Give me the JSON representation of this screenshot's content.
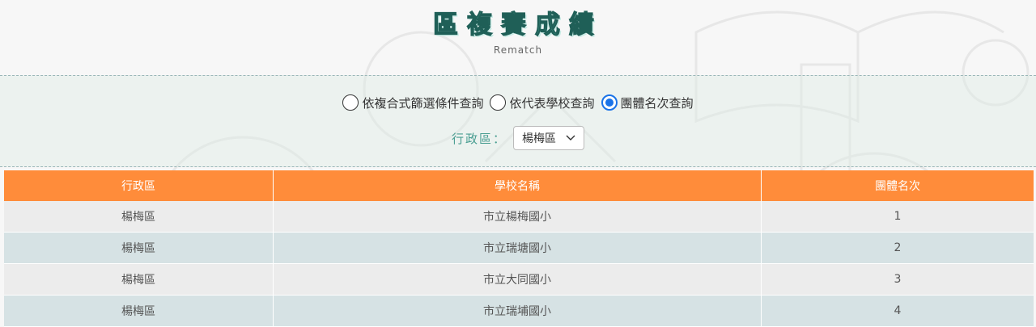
{
  "header": {
    "title": "區複賽成績",
    "subtitle": "Rematch"
  },
  "filters": {
    "options": [
      {
        "label": "依複合式篩選條件查詢",
        "checked": false
      },
      {
        "label": "依代表學校查詢",
        "checked": false
      },
      {
        "label": "團體名次查詢",
        "checked": true
      }
    ],
    "district_label": "行政區：",
    "district_value": "楊梅區"
  },
  "table": {
    "headers": [
      "行政區",
      "學校名稱",
      "團體名次"
    ],
    "rows": [
      [
        "楊梅區",
        "市立楊梅國小",
        "1"
      ],
      [
        "楊梅區",
        "市立瑞塘國小",
        "2"
      ],
      [
        "楊梅區",
        "市立大同國小",
        "3"
      ],
      [
        "楊梅區",
        "市立瑞埔國小",
        "4"
      ]
    ]
  },
  "colors": {
    "title": "#52b8a8",
    "header_bg": "#ff8c3a",
    "row_odd": "#ececec",
    "row_even": "#d6e2e4",
    "radio_checked": "#1a73e8"
  },
  "icons": {
    "select": "chevron-down-icon",
    "background": "book-and-students-illustration"
  }
}
